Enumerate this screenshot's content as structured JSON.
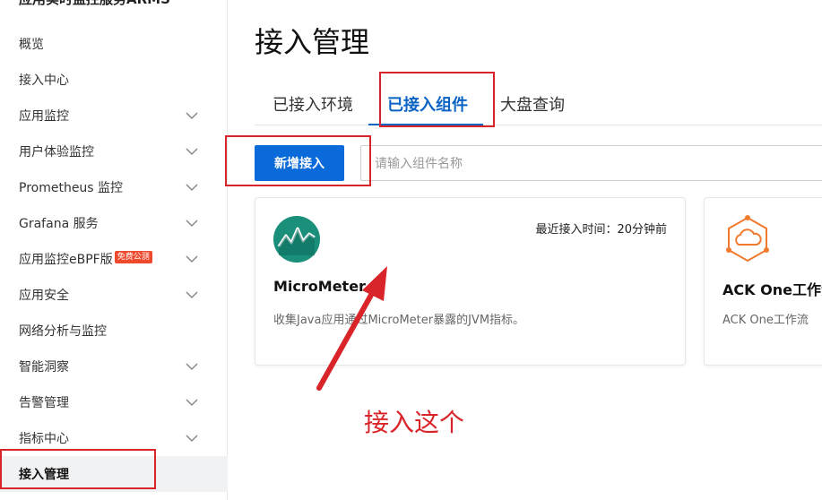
{
  "sidebar": {
    "title": "应用实时监控服务ARMS",
    "items": [
      {
        "label": "概览",
        "has_chevron": false
      },
      {
        "label": "接入中心",
        "has_chevron": false
      },
      {
        "label": "应用监控",
        "has_chevron": true
      },
      {
        "label": "用户体验监控",
        "has_chevron": true
      },
      {
        "label": "Prometheus 监控",
        "has_chevron": true
      },
      {
        "label": "Grafana 服务",
        "has_chevron": true
      },
      {
        "label": "应用监控eBPF版",
        "badge": "免费公测",
        "has_chevron": true
      },
      {
        "label": "应用安全",
        "has_chevron": true
      },
      {
        "label": "网络分析与监控",
        "has_chevron": false
      },
      {
        "label": "智能洞察",
        "has_chevron": true
      },
      {
        "label": "告警管理",
        "has_chevron": true
      },
      {
        "label": "指标中心",
        "has_chevron": true
      },
      {
        "label": "接入管理",
        "has_chevron": false,
        "active": true
      }
    ]
  },
  "main": {
    "title": "接入管理",
    "tabs": [
      {
        "label": "已接入环境"
      },
      {
        "label": "已接入组件",
        "active": true
      },
      {
        "label": "大盘查询"
      }
    ],
    "new_button_label": "新增接入",
    "search_placeholder": "请输入组件名称",
    "cards": [
      {
        "icon": "micrometer-logo-icon",
        "last_access": "最近接入时间：20分钟前",
        "name": "MicroMeter",
        "description": "收集Java应用通过MicroMeter暴露的JVM指标。"
      },
      {
        "icon": "ack-one-workflow-logo-icon",
        "name": "ACK One工作流",
        "description": "ACK One工作流"
      }
    ]
  },
  "annotation": {
    "text": "接入这个"
  },
  "colors": {
    "primary": "#0a6ad9",
    "tab_active": "#0b63c4",
    "annotation_red": "#d9252a",
    "badge": "#ee4a2e",
    "micrometer_teal": "#1a8f7a",
    "ack_orange": "#f07a2e"
  }
}
